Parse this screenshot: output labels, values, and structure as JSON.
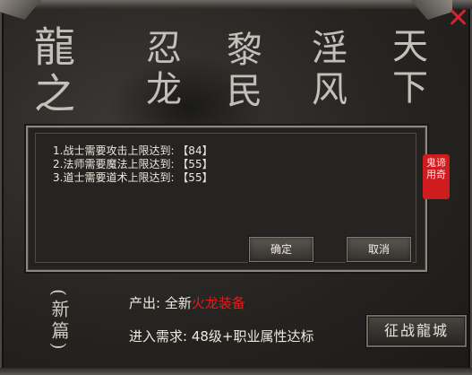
{
  "background_calligraphy": {
    "col1": "龍之",
    "col2": "忍龙",
    "col3": "黎民",
    "col4": "淫风",
    "col5": "天下"
  },
  "subtitle_vertical": "(新篇)",
  "dialog": {
    "lines": [
      "1.战士需要攻击上限达到: 【84】",
      "2.法师需要魔法上限达到: 【55】",
      "3.道士需要道术上限达到: 【55】"
    ],
    "ok_label": "确定",
    "cancel_label": "取消"
  },
  "seal_text": "鬼谛\n用奇",
  "info": {
    "output_label": "产出:",
    "output_prefix": "全新",
    "output_highlight": "火龙装备",
    "requirement_label": "进入需求:",
    "requirement_value": "48级+职业属性达标"
  },
  "enter_button_label": "征战龍城",
  "colors": {
    "highlight_red": "#e11d1d",
    "close_red": "#d3252c",
    "seal_red": "#cf1c1f"
  },
  "icons": {
    "close": "close-icon"
  }
}
